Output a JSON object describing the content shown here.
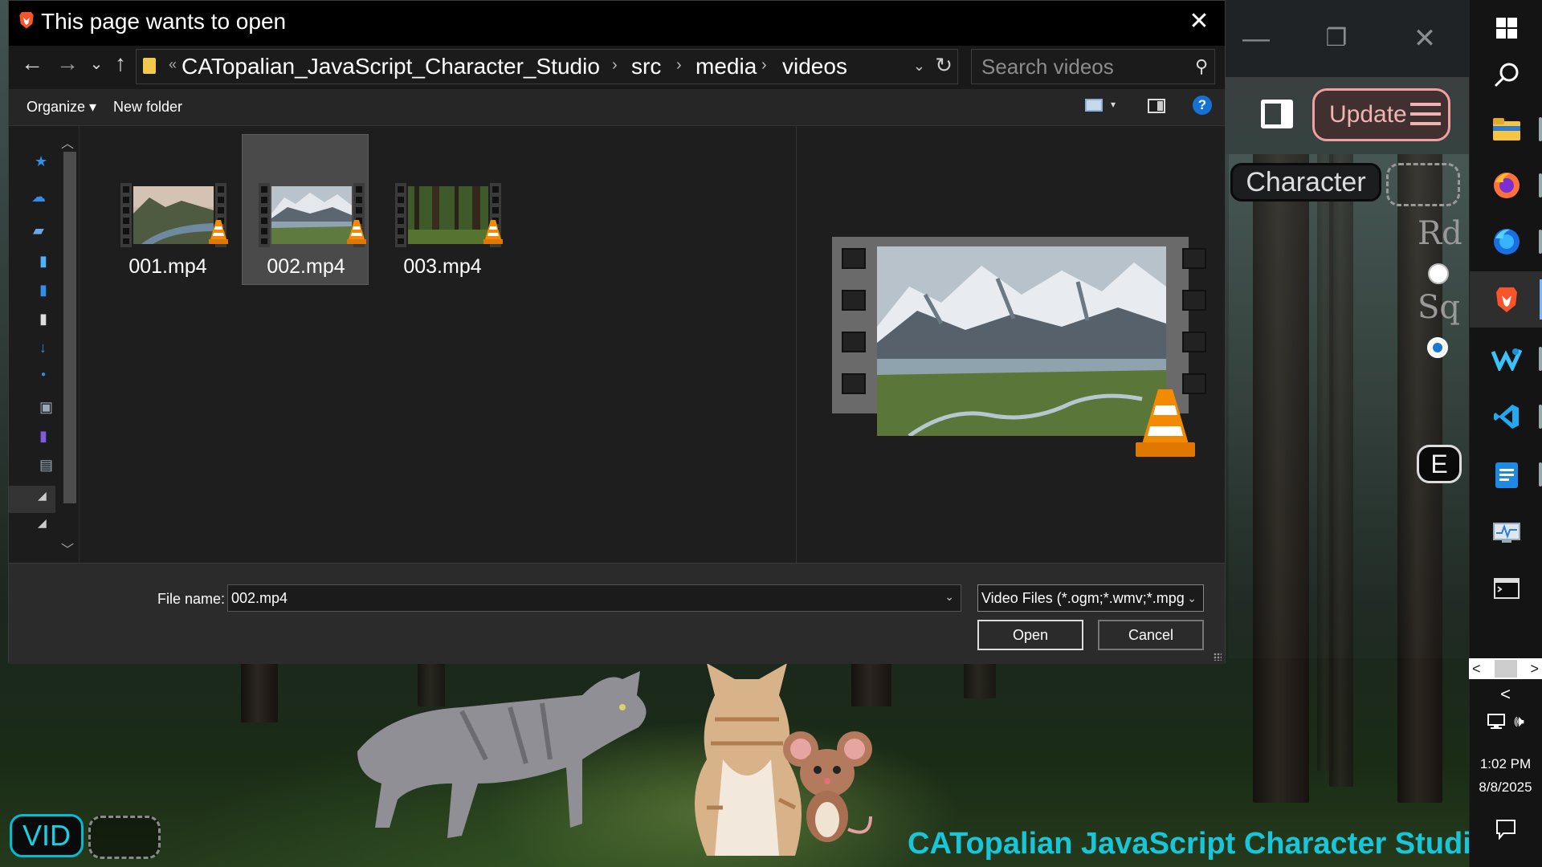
{
  "dialog": {
    "title": "This page wants to open",
    "close_glyph": "✕",
    "nav": {
      "back": "←",
      "forward": "→",
      "recent": "⌄",
      "up": "↑"
    },
    "breadcrumb_prefix": "«",
    "breadcrumb": [
      "CATopalian_JavaScript_Character_Studio",
      "src",
      "media",
      "videos"
    ],
    "breadcrumb_separator": "›",
    "address_dropdown_glyph": "⌄",
    "refresh_glyph": "↻",
    "search_placeholder": "Search videos",
    "toolbar": {
      "organize": "Organize ▾",
      "new_folder": "New folder",
      "help": "?",
      "view_dropdown": "▾"
    },
    "files": [
      {
        "name": "001.mp4",
        "selected": false,
        "thumb": "coastal-mountain-valley"
      },
      {
        "name": "002.mp4",
        "selected": true,
        "thumb": "snowy-mountain-valley"
      },
      {
        "name": "003.mp4",
        "selected": false,
        "thumb": "forest"
      }
    ],
    "preview_thumb": "snowy-mountain-valley",
    "file_name_label": "File name:",
    "file_name_value": "002.mp4",
    "file_type_filter": "Video Files (*.ogm;*.wmv;*.mpg",
    "open_label": "Open",
    "cancel_label": "Cancel",
    "dropdown_glyph": "⌄",
    "scroll_up": "︿",
    "scroll_down": "﹀"
  },
  "app": {
    "update_label": "Update",
    "character_label": "Character",
    "shape_labels": [
      "Rd",
      "Sq"
    ],
    "shape_selected": "Sq",
    "e_label": "E",
    "vid_label": "VID",
    "studio_title": "CATopalian JavaScript Character Studio",
    "window_controls": {
      "minimize": "—",
      "restore": "❐",
      "close": "✕"
    },
    "accent_color": "#17c6d8",
    "update_color": "#f1b3b3"
  },
  "taskbar": {
    "apps": [
      "windows-start",
      "search",
      "file-explorer",
      "firefox",
      "firefox-developer",
      "brave",
      "windsurf",
      "vscode",
      "notepad",
      "task-manager",
      "terminal"
    ],
    "active_app": "brave",
    "time": "1:02 PM",
    "date": "8/8/2025",
    "scroll_left": "<",
    "scroll_right": ">",
    "tray_chevron": "<",
    "speaker": "🕪"
  }
}
